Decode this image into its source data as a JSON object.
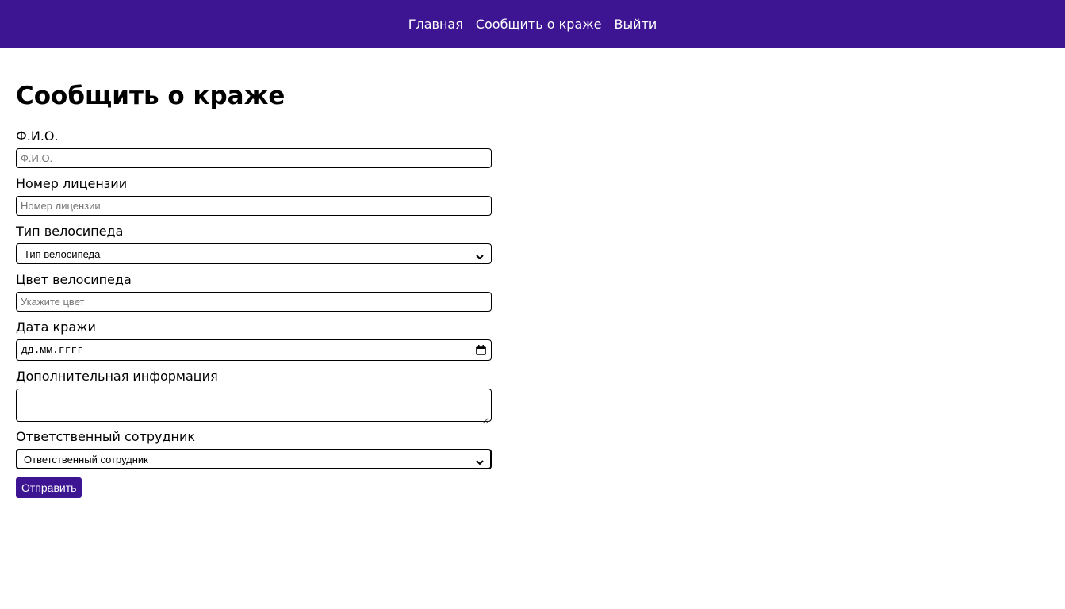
{
  "colors": {
    "brand": "#3d1592",
    "text": "#000000",
    "background": "#ffffff"
  },
  "nav": {
    "items": [
      {
        "label": "Главная"
      },
      {
        "label": "Сообщить о краже"
      },
      {
        "label": "Выйти"
      }
    ]
  },
  "page": {
    "title": "Сообщить о краже"
  },
  "form": {
    "full_name": {
      "label": "Ф.И.О.",
      "placeholder": "Ф.И.О.",
      "value": ""
    },
    "license": {
      "label": "Номер лицензии",
      "placeholder": "Номер лицензии",
      "value": ""
    },
    "bike_type": {
      "label": "Тип велосипеда",
      "selected": "Тип велосипеда"
    },
    "bike_color": {
      "label": "Цвет велосипеда",
      "placeholder": "Укажите цвет",
      "value": ""
    },
    "theft_date": {
      "label": "Дата кражи",
      "value": "дд.мм.гггг"
    },
    "extra_info": {
      "label": "Дополнительная информация",
      "value": ""
    },
    "officer": {
      "label": "Ответственный сотрудник",
      "selected": "Ответственный сотрудник"
    },
    "submit_label": "Отправить"
  },
  "icons": {
    "select_arrow": "chevron-down-icon",
    "date_picker": "calendar-icon",
    "textarea_resize": "resize-handle-icon"
  }
}
